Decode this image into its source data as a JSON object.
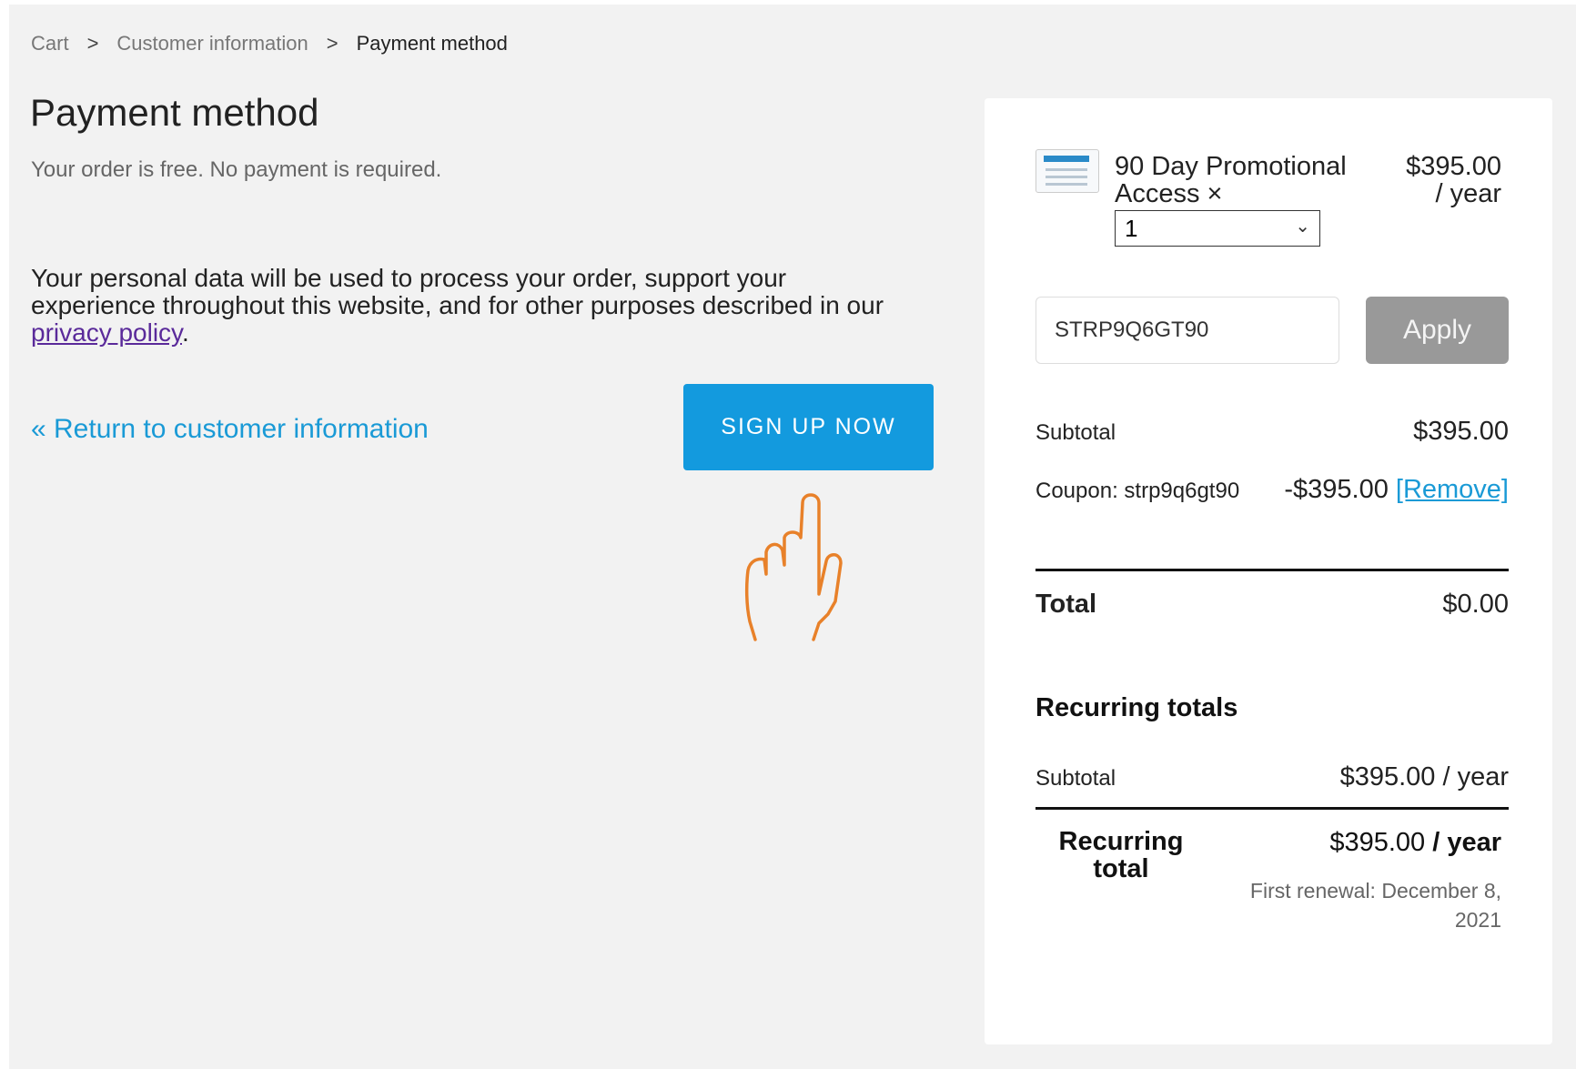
{
  "breadcrumb": {
    "items": [
      "Cart",
      "Customer information",
      "Payment method"
    ],
    "separator": ">"
  },
  "page": {
    "title": "Payment method",
    "subtitle": "Your order is free. No payment is required.",
    "privacy_text_before": "Your personal data will be used to process your order, support your experience throughout this website, and for other purposes described in our ",
    "privacy_link": "privacy policy",
    "privacy_text_after": ".",
    "return_link": "« Return to customer information",
    "signup_button": "SIGN UP NOW"
  },
  "summary": {
    "product": {
      "name": "90 Day Promotional Access ×",
      "price": "$395.00",
      "period": "/ year",
      "quantity": "1"
    },
    "coupon_input": {
      "value": "STRP9Q6GT90"
    },
    "apply_button": "Apply",
    "subtotal": {
      "label": "Subtotal",
      "value": "$395.00"
    },
    "coupon": {
      "label": "Coupon: strp9q6gt90",
      "value": "-$395.00",
      "remove": "[Remove]"
    },
    "total": {
      "label": "Total",
      "value": "$0.00"
    },
    "recurring": {
      "heading": "Recurring totals",
      "subtotal_label": "Subtotal",
      "subtotal_value": "$395.00 / year",
      "total_label": "Recurring total",
      "total_amount": "$395.00",
      "total_period": "/ year",
      "first_renewal": "First renewal: December 8, 2021"
    }
  },
  "colors": {
    "accent": "#139ade",
    "link": "#1a9ad6",
    "visited_link": "#5a2a9a",
    "apply_disabled": "#999999",
    "hand_cursor": "#e8812a"
  },
  "icons": [
    "chevron-right-icon",
    "chevron-down-icon",
    "pointing-hand-icon",
    "product-thumbnail"
  ]
}
